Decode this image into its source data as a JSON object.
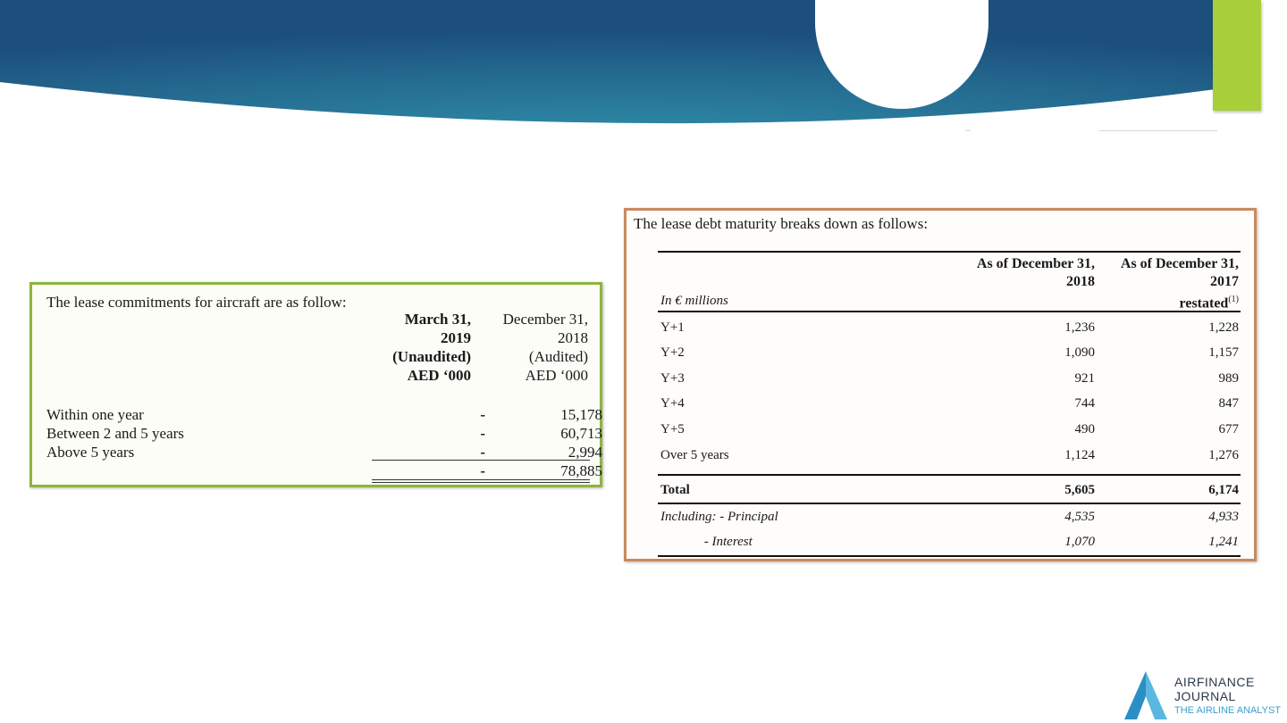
{
  "left_table": {
    "caption": "The lease commitments for aircraft are as follow:",
    "col1_header": [
      "March 31,",
      "2019",
      "(Unaudited)",
      "AED ‘000"
    ],
    "col2_header": [
      "December 31,",
      "2018",
      "(Audited)",
      "AED ‘000"
    ],
    "rows": [
      {
        "label": "Within one year",
        "v1": "-",
        "v2": "15,178"
      },
      {
        "label": "Between 2 and 5 years",
        "v1": "-",
        "v2": "60,713"
      },
      {
        "label": "Above 5 years",
        "v1": "-",
        "v2": "2,994"
      }
    ],
    "total": {
      "label": "",
      "v1": "-",
      "v2": "78,885"
    }
  },
  "right_table": {
    "caption": "The lease debt maturity breaks down as follows:",
    "col1_header": [
      "As of December 31,",
      "2018"
    ],
    "col2_header": [
      "As of December 31,",
      "2017",
      "restated"
    ],
    "col2_footnote": "(1)",
    "unit": "In € millions",
    "rows": [
      {
        "label": "Y+1",
        "v1": "1,236",
        "v2": "1,228"
      },
      {
        "label": "Y+2",
        "v1": "1,090",
        "v2": "1,157"
      },
      {
        "label": "Y+3",
        "v1": "921",
        "v2": "989"
      },
      {
        "label": "Y+4",
        "v1": "744",
        "v2": "847"
      },
      {
        "label": "Y+5",
        "v1": "490",
        "v2": "677"
      },
      {
        "label": "Over 5 years",
        "v1": "1,124",
        "v2": "1,276"
      }
    ],
    "total": {
      "label": "Total",
      "v1": "5,605",
      "v2": "6,174"
    },
    "including": [
      {
        "label": "Including: - Principal",
        "v1": "4,535",
        "v2": "4,933"
      },
      {
        "label": "             - Interest",
        "v1": "1,070",
        "v2": "1,241"
      }
    ]
  },
  "logo": {
    "line1": "AIRFINANCE",
    "line2": "JOURNAL",
    "line3": "THE AIRLINE ANALYST"
  },
  "colors": {
    "banner_dark": "#1c4f7c",
    "banner_light": "#2e8ba8",
    "accent_green": "#a8cf3a",
    "left_border": "#8cb63c",
    "right_border": "#c98a5e",
    "logo_blue": "#3aa0d0"
  }
}
